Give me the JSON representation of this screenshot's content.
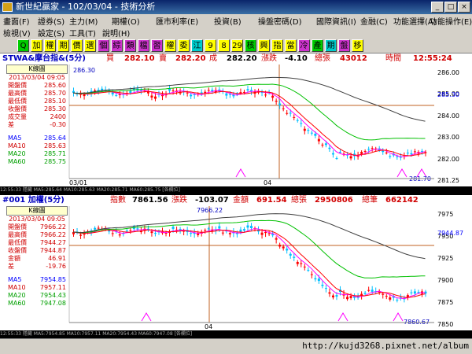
{
  "window": {
    "title": "新世紀贏家 - 102/03/04 - 技術分析",
    "min": "_",
    "max": "□",
    "close": "×"
  },
  "menu": {
    "row1": [
      "畫面(F)",
      "證券(S)",
      "主力(M)",
      "期權(O)",
      "匯市利率(E)",
      "投資(B)",
      "操盤密碼(D)",
      "國際資訊(I)",
      "金融(C)",
      "功能選擇(A)",
      "功能操作(E)"
    ],
    "row2": [
      "檢視(V)",
      "設定(S)",
      "工具(T)",
      "說明(H)"
    ]
  },
  "toolbar": {
    "buttons": [
      "Q",
      "加",
      "權",
      "期",
      "價",
      "選",
      "個",
      "綜",
      "類",
      "檔",
      "習",
      "權",
      "委",
      "江",
      "9",
      "8",
      "29",
      "核",
      "興",
      "指",
      "當",
      "冷",
      "產",
      "期",
      "盤",
      "移"
    ],
    "colors": [
      "#0c0",
      "#ff0",
      "#ff0",
      "#ff0",
      "#ff0",
      "#ff0",
      "#c3c",
      "#c3c",
      "#c3c",
      "#c3c",
      "#c3c",
      "#ff0",
      "#ff0",
      "#0cc",
      "#ff0",
      "#ff0",
      "#ff0",
      "#0c0",
      "#ff0",
      "#ff0",
      "#ff0",
      "#c3c",
      "#0c0",
      "#0cc",
      "#c3c",
      "#ff0"
    ]
  },
  "panel1": {
    "symbol": "STWA&摩台指&(5分)",
    "bid_label": "買",
    "bid": "282.10",
    "ask_label": "賣",
    "ask": "282.20",
    "last_label": "成",
    "last": "282.20",
    "chg_label": "漲跌",
    "chg": "-4.10",
    "vol_label": "總張",
    "vol": "43012",
    "time_label": "時間",
    "time": "12:55:24",
    "box": {
      "header": "K線圖",
      "date": "2013/03/04 09:05",
      "rows": [
        {
          "k": "開盤價",
          "v": "285.60"
        },
        {
          "k": "最高價",
          "v": "285.70"
        },
        {
          "k": "最低價",
          "v": "285.10"
        },
        {
          "k": "收盤價",
          "v": "285.30"
        },
        {
          "k": "成交量",
          "v": "2400"
        },
        {
          "k": "差",
          "v": "-0.30"
        }
      ],
      "ma": [
        {
          "k": "MA5",
          "v": "285.64"
        },
        {
          "k": "MA10",
          "v": "285.63"
        },
        {
          "k": "MA20",
          "v": "285.71"
        },
        {
          "k": "MA60",
          "v": "285.75"
        }
      ]
    },
    "yticks": [
      "286.00",
      "285.00",
      "284.00",
      "283.00",
      "282.00",
      "281.25"
    ],
    "current_price_label": "285.30",
    "peak_label": "286.30",
    "trough_label": "281.70",
    "xlabels": [
      "03/01",
      "04"
    ],
    "status": "12:55:33 隱藏 MA5:285.64 MA10:285.63 MA20:285.71 MA60:285.75 [各欄位]"
  },
  "panel2": {
    "symbol": "#001 加權(5分)",
    "index_label": "指數",
    "index": "7861.56",
    "chg_label": "漲跌",
    "chg": "-103.07",
    "amt_label": "金額",
    "amt": "691.54",
    "vol_label": "總張",
    "vol": "2950806",
    "trades_label": "總筆",
    "trades": "662142",
    "box": {
      "header": "K線圖",
      "date": "2013/03/04 09:05",
      "rows": [
        {
          "k": "開盤價",
          "v": "7966.22"
        },
        {
          "k": "最高價",
          "v": "7966.22"
        },
        {
          "k": "最低價",
          "v": "7944.27"
        },
        {
          "k": "收盤價",
          "v": "7944.87"
        },
        {
          "k": "金額",
          "v": "46.91"
        },
        {
          "k": "差",
          "v": "-19.76"
        }
      ],
      "ma": [
        {
          "k": "MA5",
          "v": "7954.85"
        },
        {
          "k": "MA10",
          "v": "7957.11"
        },
        {
          "k": "MA20",
          "v": "7954.43"
        },
        {
          "k": "MA60",
          "v": "7947.08"
        }
      ]
    },
    "yticks": [
      "7975",
      "7950",
      "7925",
      "7900",
      "7875",
      "7850"
    ],
    "current_price_label": "7944.87",
    "peak_label": "7966.22",
    "trough_label": "7860.67",
    "xlabels": [
      "04"
    ],
    "status": "12:55:33 隱藏 MA5:7954.85 MA10:7957.11 MA20:7954.43 MA60:7947.08 [各欄位]"
  },
  "footer": {
    "url": "http://kujd3268.pixnet.net/album"
  },
  "colors": {
    "up": "#ff0000",
    "down": "#00bfff",
    "ma5": "#ff00ff",
    "ma10": "#ff0000",
    "ma20": "#00c000",
    "ma60": "#404040",
    "blue": "#0000ff"
  }
}
